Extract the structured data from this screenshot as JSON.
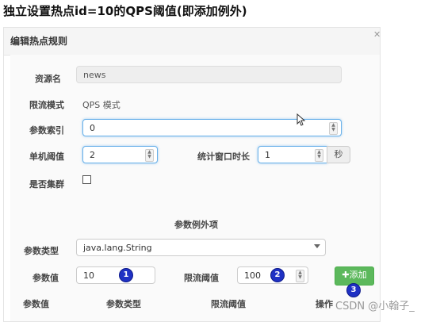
{
  "page": {
    "heading": "独立设置热点id=10的QPS阈值(即添加例外)"
  },
  "dialog": {
    "title": "编辑热点规则",
    "close_icon": "close-icon"
  },
  "form": {
    "resource_label": "资源名",
    "resource_value": "news",
    "flow_mode_label": "限流模式",
    "flow_mode_value": "QPS 模式",
    "param_index_label": "参数索引",
    "param_index_value": "0",
    "threshold_label": "单机阈值",
    "threshold_value": "2",
    "window_label": "统计窗口时长",
    "window_value": "1",
    "window_unit": "秒",
    "cluster_label": "是否集群",
    "cluster_checked": false
  },
  "exceptions": {
    "section_title": "参数例外项",
    "param_type_label": "参数类型",
    "param_type_value": "java.lang.String",
    "param_value_label": "参数值",
    "param_value": "10",
    "limit_label": "限流阈值",
    "limit_value": "100",
    "add_button": "添加",
    "add_icon": "plus-icon"
  },
  "markers": [
    "1",
    "2",
    "3"
  ],
  "table": {
    "columns": [
      "参数值",
      "参数类型",
      "限流阈值",
      "操作"
    ]
  },
  "watermark": "CSDN @小翰子_",
  "colors": {
    "add_button": "#5cb85c",
    "marker": "#1f31c4",
    "focus_border": "#66afe9"
  }
}
